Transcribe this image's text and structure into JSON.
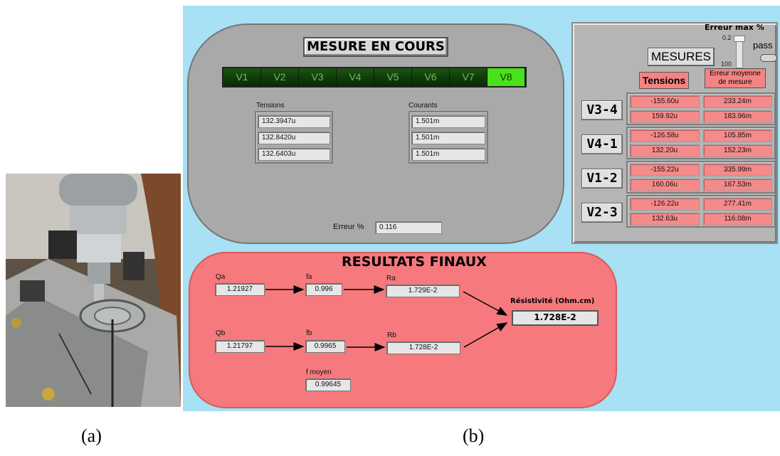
{
  "captions": {
    "a": "(a)",
    "b": "(b)"
  },
  "mesure": {
    "title": "MESURE EN COURS",
    "leds": [
      "V1",
      "V2",
      "V3",
      "V4",
      "V5",
      "V6",
      "V7",
      "V8"
    ],
    "active_led": "V8",
    "tensions_label": "Tensions",
    "tensions": [
      "132.3947u",
      "132.8420u",
      "132.6403u"
    ],
    "courants_label": "Courants",
    "courants": [
      "1.501m",
      "1.501m",
      "1.501m"
    ],
    "erreur_label": "Erreur %",
    "erreur_value": "0.116"
  },
  "mesures_panel": {
    "erreur_max_label": "Erreur max %",
    "slider_max": "0.2",
    "slider_min": "100",
    "pass_label": "pass",
    "button_label": "MESURES",
    "hdr_tensions": "Tensions",
    "hdr_erreur": "Erreur moyenne de mesure",
    "groups": [
      {
        "label": "V3-4",
        "rows": [
          [
            "-155.60u",
            "233.24m"
          ],
          [
            "159.92u",
            "183.96m"
          ]
        ]
      },
      {
        "label": "V4-1",
        "rows": [
          [
            "-126.58u",
            "105.85m"
          ],
          [
            "132.20u",
            "152.23m"
          ]
        ]
      },
      {
        "label": "V1-2",
        "rows": [
          [
            "-155.22u",
            "335.99m"
          ],
          [
            "160.06u",
            "167.53m"
          ]
        ]
      },
      {
        "label": "V2-3",
        "rows": [
          [
            "-126.22u",
            "277.41m"
          ],
          [
            "132.63u",
            "116.08m"
          ]
        ]
      }
    ]
  },
  "resultats": {
    "title": "RESULTATS FINAUX",
    "qa_label": "Qa",
    "qa": "1.21927",
    "fa_label": "fa",
    "fa": "0.996",
    "ra_label": "Ra",
    "ra": "1.729E-2",
    "qb_label": "Qb",
    "qb": "1.21797",
    "fb_label": "fb",
    "fb": "0.9965",
    "rb_label": "Rb",
    "rb": "1.728E-2",
    "fmoyen_label": "f moyen",
    "fmoyen": "0.99645",
    "resistivite_label": "Résistivité (Ohm.cm)",
    "resistivite": "1.728E-2"
  }
}
